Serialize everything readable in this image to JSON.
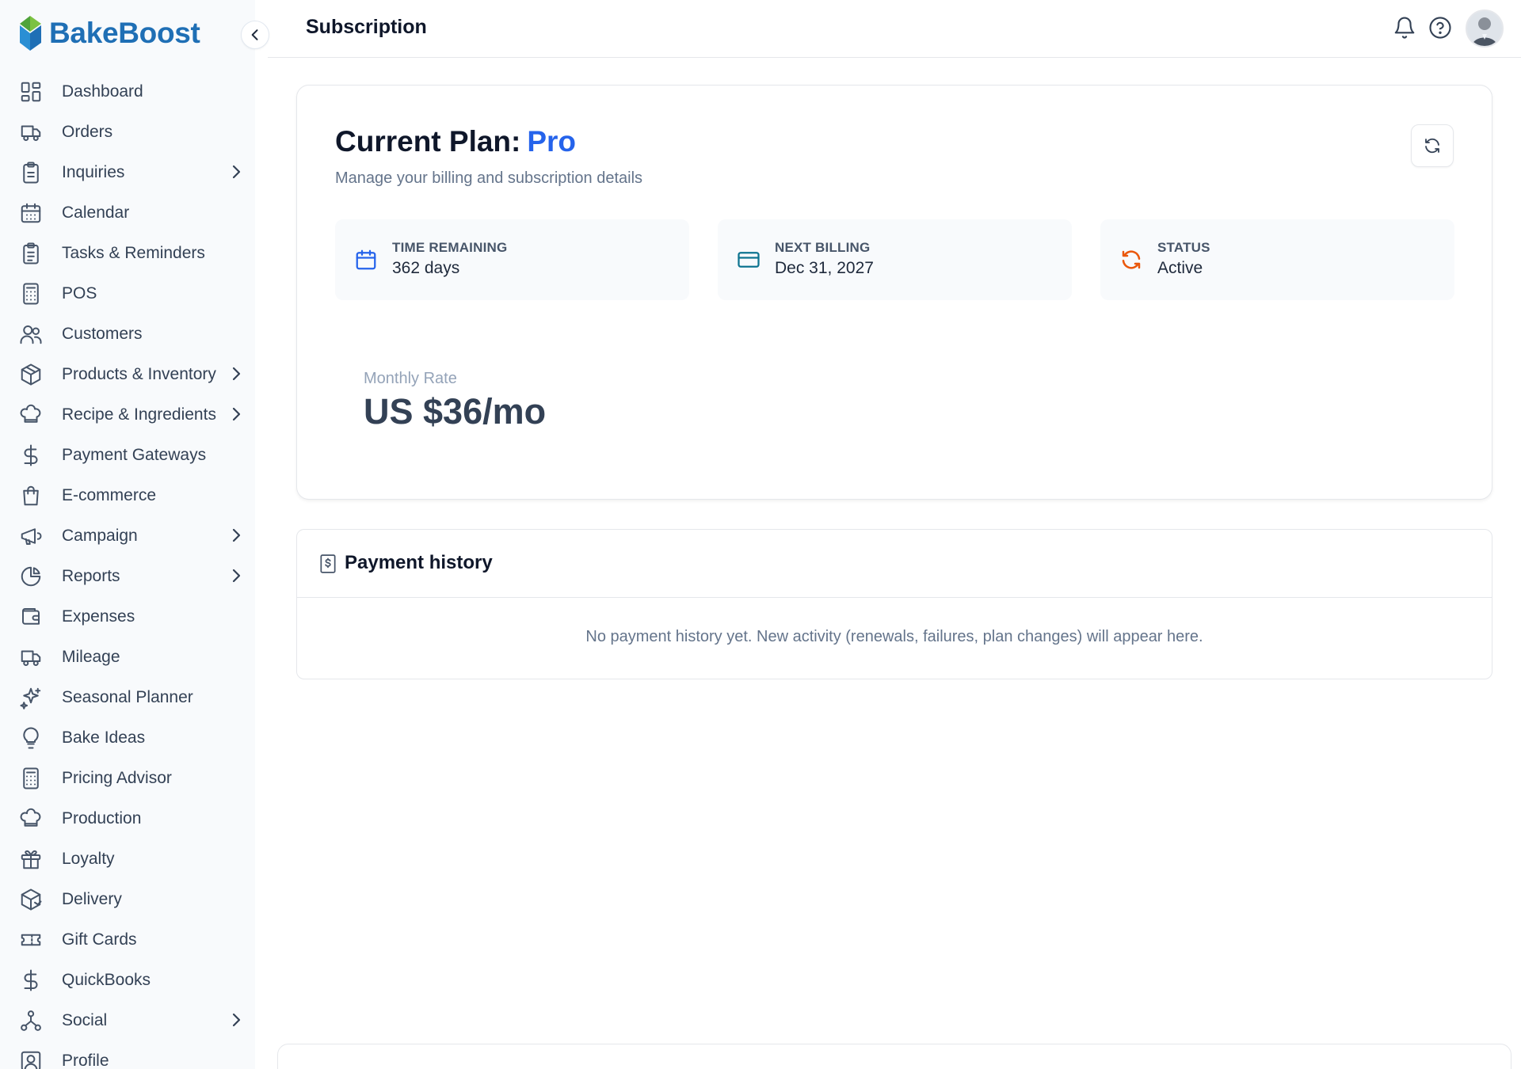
{
  "app": {
    "name": "BakeBoost"
  },
  "sidebar": {
    "items": [
      {
        "label": "Dashboard",
        "icon": "dashboard-icon",
        "has_submenu": false
      },
      {
        "label": "Orders",
        "icon": "truck-icon",
        "has_submenu": false
      },
      {
        "label": "Inquiries",
        "icon": "clipboard-icon",
        "has_submenu": true
      },
      {
        "label": "Calendar",
        "icon": "calendar-icon",
        "has_submenu": false
      },
      {
        "label": "Tasks & Reminders",
        "icon": "clipboard-list-icon",
        "has_submenu": false
      },
      {
        "label": "POS",
        "icon": "calculator-icon",
        "has_submenu": false
      },
      {
        "label": "Customers",
        "icon": "users-icon",
        "has_submenu": false
      },
      {
        "label": "Products & Inventory",
        "icon": "box-icon",
        "has_submenu": true
      },
      {
        "label": "Recipe & Ingredients",
        "icon": "chef-hat-icon",
        "has_submenu": true
      },
      {
        "label": "Payment Gateways",
        "icon": "dollar-icon",
        "has_submenu": false
      },
      {
        "label": "E-commerce",
        "icon": "shopping-bag-icon",
        "has_submenu": false
      },
      {
        "label": "Campaign",
        "icon": "megaphone-icon",
        "has_submenu": true
      },
      {
        "label": "Reports",
        "icon": "pie-chart-icon",
        "has_submenu": true
      },
      {
        "label": "Expenses",
        "icon": "wallet-icon",
        "has_submenu": false
      },
      {
        "label": "Mileage",
        "icon": "truck-icon",
        "has_submenu": false
      },
      {
        "label": "Seasonal Planner",
        "icon": "sparkles-icon",
        "has_submenu": false
      },
      {
        "label": "Bake Ideas",
        "icon": "lightbulb-icon",
        "has_submenu": false
      },
      {
        "label": "Pricing Advisor",
        "icon": "calculator-icon",
        "has_submenu": false
      },
      {
        "label": "Production",
        "icon": "chef-hat-icon",
        "has_submenu": false
      },
      {
        "label": "Loyalty",
        "icon": "gift-icon",
        "has_submenu": false
      },
      {
        "label": "Delivery",
        "icon": "package-icon",
        "has_submenu": false
      },
      {
        "label": "Gift Cards",
        "icon": "ticket-icon",
        "has_submenu": false
      },
      {
        "label": "QuickBooks",
        "icon": "dollar-icon",
        "has_submenu": false
      },
      {
        "label": "Social",
        "icon": "share-network-icon",
        "has_submenu": true
      },
      {
        "label": "Profile",
        "icon": "user-square-icon",
        "has_submenu": false
      }
    ]
  },
  "header": {
    "title": "Subscription"
  },
  "plan": {
    "title_prefix": "Current Plan:",
    "name": "Pro",
    "subtitle": "Manage your billing and subscription details",
    "stats": [
      {
        "label": "TIME REMAINING",
        "value": "362 days",
        "icon": "calendar-icon",
        "color": "#2563eb"
      },
      {
        "label": "NEXT BILLING",
        "value": "Dec 31, 2027",
        "icon": "credit-card-icon",
        "color": "#0e7490"
      },
      {
        "label": "STATUS",
        "value": "Active",
        "icon": "refresh-icon",
        "color": "#ea580c"
      }
    ],
    "rate_label": "Monthly Rate",
    "rate_value": "US $36/mo"
  },
  "history": {
    "title": "Payment history",
    "empty_text": "No payment history yet. New activity (renewals, failures, plan changes) will appear here."
  },
  "colors": {
    "brand": "#1f6fb5",
    "accent": "#2563eb",
    "logo_green": "#7cc242"
  }
}
